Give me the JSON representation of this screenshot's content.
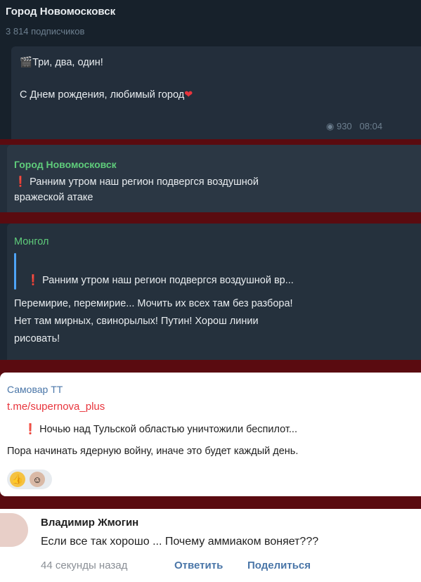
{
  "post1": {
    "channel_title": "Город Новомосковск",
    "subscribers": "3 814 подписчиков",
    "line1_emoji_icon": "clapper-board-icon",
    "line1": "Три, два, один!",
    "line2": "С Днем рождения, любимый город",
    "line2_emoji_icon": "heart-icon",
    "views": "930",
    "time": "08:04"
  },
  "post2": {
    "author": "Город Новомосковск",
    "line1": "Ранним утром наш регион подвергся воздушной",
    "line2": "вражеской атаке"
  },
  "post3": {
    "author": "Монгол",
    "quote": "Ранним утром наш регион подвергся воздушной вр...",
    "body_line1": "Перемирие, перемирие... Мочить их всех там без разбора!",
    "body_line2": "Нет там мирных, свинорылых! Путин! Хорош линии",
    "body_line3": "рисовать!"
  },
  "post4": {
    "author": "Самовар ТТ",
    "link": "t.me/supernova_plus",
    "quote": "Ночью над Тульской областью уничтожили беспилот...",
    "body": "Пора начинать ядерную войну, иначе это будет каждый день.",
    "reactions": [
      "thumbs-up-icon",
      "avatar-icon"
    ]
  },
  "comment": {
    "author": "Владимир Жмогин",
    "text": "Если все так хорошо ... Почему аммиаком воняет???",
    "time": "44 секунды назад",
    "reply_label": "Ответить",
    "share_label": "Поделиться"
  },
  "colors": {
    "dark_bg": "#17212b",
    "separator": "#5a0b10",
    "green_author": "#5fcc7b",
    "link_red": "#e8343c",
    "vk_blue": "#4a76a8"
  }
}
